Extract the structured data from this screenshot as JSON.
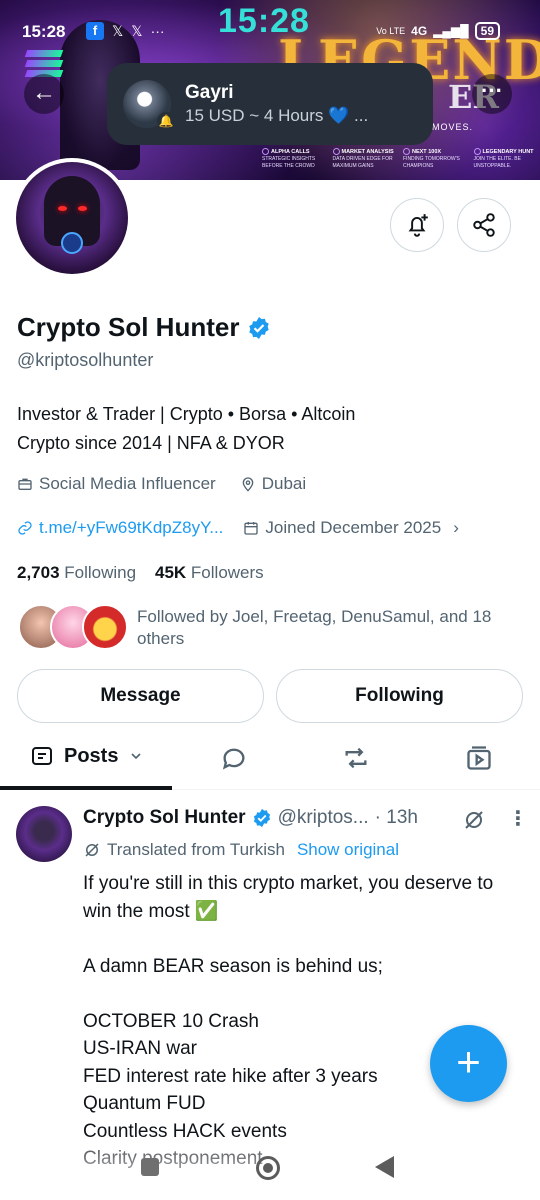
{
  "status_bar": {
    "time": "15:28",
    "clock_overlay": "15:28",
    "network": "4G",
    "volte": "Vo LTE",
    "battery": "59"
  },
  "banner": {
    "logo_text": "LEGEND",
    "logo_tail": "ER",
    "tagline": "MOVES.",
    "strip": [
      {
        "title": "ALPHA CALLS",
        "sub": "STRATEGIC INSIGHTS BEFORE THE CROWD"
      },
      {
        "title": "MARKET ANALYSIS",
        "sub": "DATA DRIVEN EDGE FOR MAXIMUM GAINS"
      },
      {
        "title": "NEXT 100X",
        "sub": "FINDING TOMORROW'S CHAMPIONS"
      },
      {
        "title": "LEGENDARY HUNT",
        "sub": "JOIN THE ELITE. BE UNSTOPPABLE."
      }
    ]
  },
  "notification": {
    "name": "Gayri",
    "message": "15 USD ~ 4 Hours 💙 ..."
  },
  "profile": {
    "display_name": "Crypto Sol Hunter",
    "handle": "@kriptosolhunter",
    "bio_line1": "Investor & Trader | Crypto • Borsa • Altcoin",
    "bio_line2": "Crypto since 2014 | NFA & DYOR",
    "category": "Social Media Influencer",
    "location": "Dubai",
    "link": "t.me/+yFw69tKdpZ8yY...",
    "joined": "Joined December 2025",
    "following_count": "2,703",
    "following_label": "Following",
    "followers_count": "45K",
    "followers_label": "Followers",
    "followed_by": "Followed by Joel, Freetag, DenuSamul, and 18 others"
  },
  "buttons": {
    "message": "Message",
    "following": "Following"
  },
  "tabs": {
    "posts": "Posts"
  },
  "post": {
    "name": "Crypto Sol Hunter",
    "handle": "@kriptos...",
    "time": "· 13h",
    "translated": "Translated from Turkish",
    "show_original": "Show original",
    "text": "If you're still in this crypto market, you deserve to win the most ✅\n\nA damn BEAR season is behind us;\n\nOCTOBER 10 Crash\nUS-IRAN war\nFED interest rate hike after 3 years\nQuantum FUD\nCountless HACK events\nClarity postponement"
  },
  "colors": {
    "accent": "#1d9bf0",
    "text": "#0f1419",
    "secondary": "#536471"
  }
}
